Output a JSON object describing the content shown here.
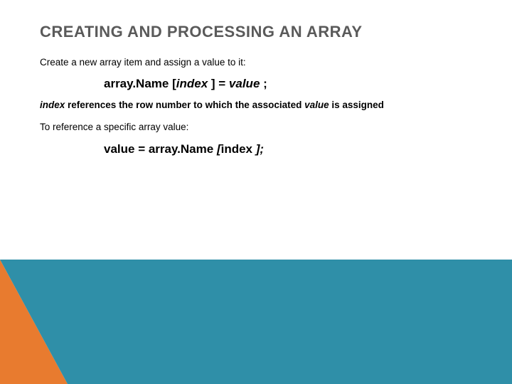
{
  "title": "CREATING AND PROCESSING AN ARRAY",
  "line1": "Create a new array item and assign a value to it:",
  "code1_a": "array.Name [",
  "code1_b": "index",
  "code1_c": " ] =  ",
  "code1_d": "value",
  "code1_e": " ;",
  "ref_a": "index",
  "ref_b": " references the row number to which the associated ",
  "ref_c": "value",
  "ref_d": " is assigned",
  "line2": "To reference a specific array value:",
  "code2_a": "value = array.Name ",
  "code2_b": "[",
  "code2_c": "index ",
  "code2_d": "];"
}
